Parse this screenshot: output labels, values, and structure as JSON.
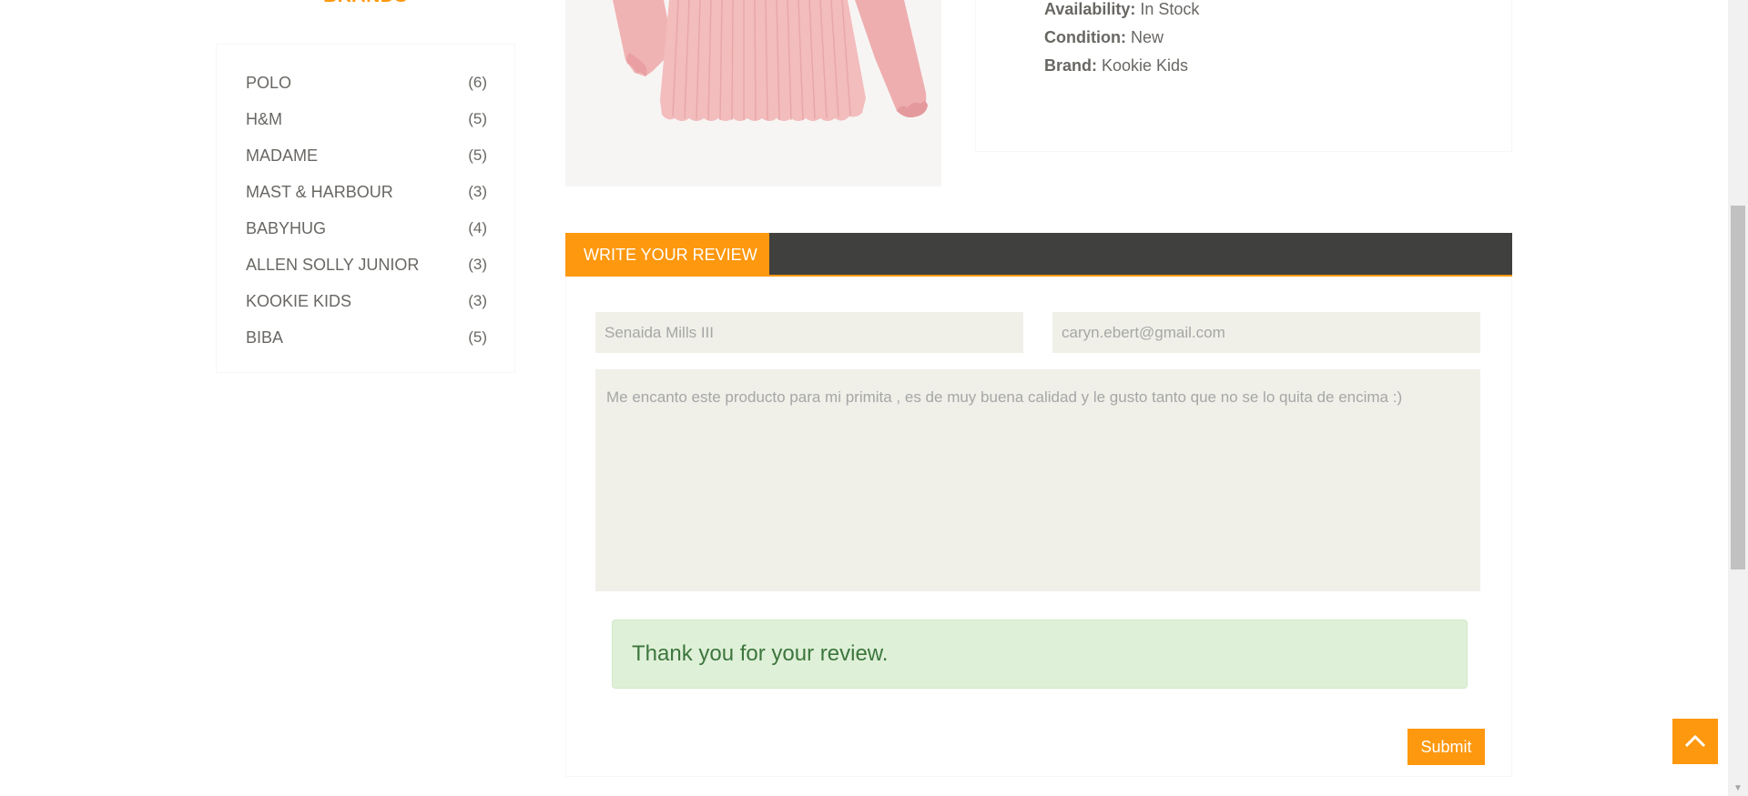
{
  "sidebar": {
    "title": "BRANDS",
    "brands": [
      {
        "name": "POLO",
        "count": "(6)"
      },
      {
        "name": "H&M",
        "count": "(5)"
      },
      {
        "name": "MADAME",
        "count": "(5)"
      },
      {
        "name": "MAST & HARBOUR",
        "count": "(3)"
      },
      {
        "name": "BABYHUG",
        "count": "(4)"
      },
      {
        "name": "ALLEN SOLLY JUNIOR",
        "count": "(3)"
      },
      {
        "name": "KOOKIE KIDS",
        "count": "(3)"
      },
      {
        "name": "BIBA",
        "count": "(5)"
      }
    ]
  },
  "product": {
    "availability_label": "Availability:",
    "availability_value": " In Stock",
    "condition_label": "Condition:",
    "condition_value": " New",
    "brand_label": "Brand:",
    "brand_value": " Kookie Kids"
  },
  "review": {
    "tab_label": "WRITE YOUR REVIEW",
    "name_value": "Senaida Mills III",
    "email_value": "caryn.ebert@gmail.com",
    "message_value": "Me encanto este producto para mi primita , es de muy buena calidad y le gusto tanto que no se lo quita de encima :)",
    "success_message": "Thank you for your review.",
    "submit_label": "Submit"
  },
  "colors": {
    "accent": "#fe980f",
    "dark_tab_bar": "#40403e",
    "field_background": "#f0f0e9",
    "success_background": "#dff0d8",
    "success_text": "#3c763d"
  },
  "icons": {
    "scroll_top": "chevron-up-icon"
  }
}
